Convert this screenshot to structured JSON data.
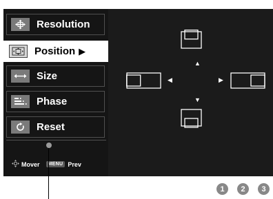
{
  "menu": {
    "items": [
      {
        "label": "Resolution",
        "icon": "resolution-icon",
        "selected": false
      },
      {
        "label": "Position",
        "icon": "position-icon",
        "selected": true,
        "submenu_arrow": "▶"
      },
      {
        "label": "Size",
        "icon": "size-icon",
        "selected": false
      },
      {
        "label": "Phase",
        "icon": "phase-icon",
        "selected": false
      },
      {
        "label": "Reset",
        "icon": "reset-icon",
        "selected": false
      }
    ],
    "footer": {
      "mover_label": "Mover",
      "menu_key": "MENU",
      "prev_label": "Prev"
    }
  },
  "callouts": [
    "1",
    "2",
    "3"
  ],
  "colors": {
    "menu_bg": "#151515",
    "panel_bg": "#1b1b1b",
    "selected_bg": "#ffffff",
    "callout_badge": "#888888"
  }
}
